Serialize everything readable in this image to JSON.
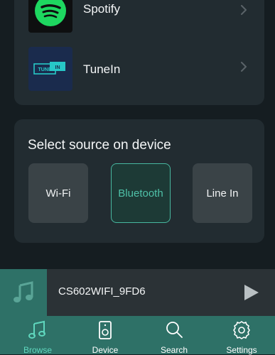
{
  "services": {
    "items": [
      {
        "label": "Spotify"
      },
      {
        "label": "TuneIn",
        "logo_text_left": "TUNE",
        "logo_text_right": "IN"
      }
    ]
  },
  "source": {
    "title": "Select source on device",
    "options": [
      {
        "label": "Wi-Fi",
        "selected": false
      },
      {
        "label": "Bluetooth",
        "selected": true
      },
      {
        "label": "Line In",
        "selected": false
      }
    ]
  },
  "player": {
    "device_name": "CS602WIFI_9FD6",
    "art_icon": "music-note-icon",
    "play_icon": "play-icon"
  },
  "tabbar": {
    "tabs": [
      {
        "label": "Browse",
        "icon": "music-note-icon",
        "active": true
      },
      {
        "label": "Device",
        "icon": "speaker-icon",
        "active": false
      },
      {
        "label": "Search",
        "icon": "search-icon",
        "active": false
      },
      {
        "label": "Settings",
        "icon": "gear-icon",
        "active": false
      }
    ]
  },
  "colors": {
    "background": "#151d21",
    "card": "#222c31",
    "accent": "#4fc1a8",
    "tabbar": "#2e7167",
    "spotify_green": "#1ed760"
  }
}
